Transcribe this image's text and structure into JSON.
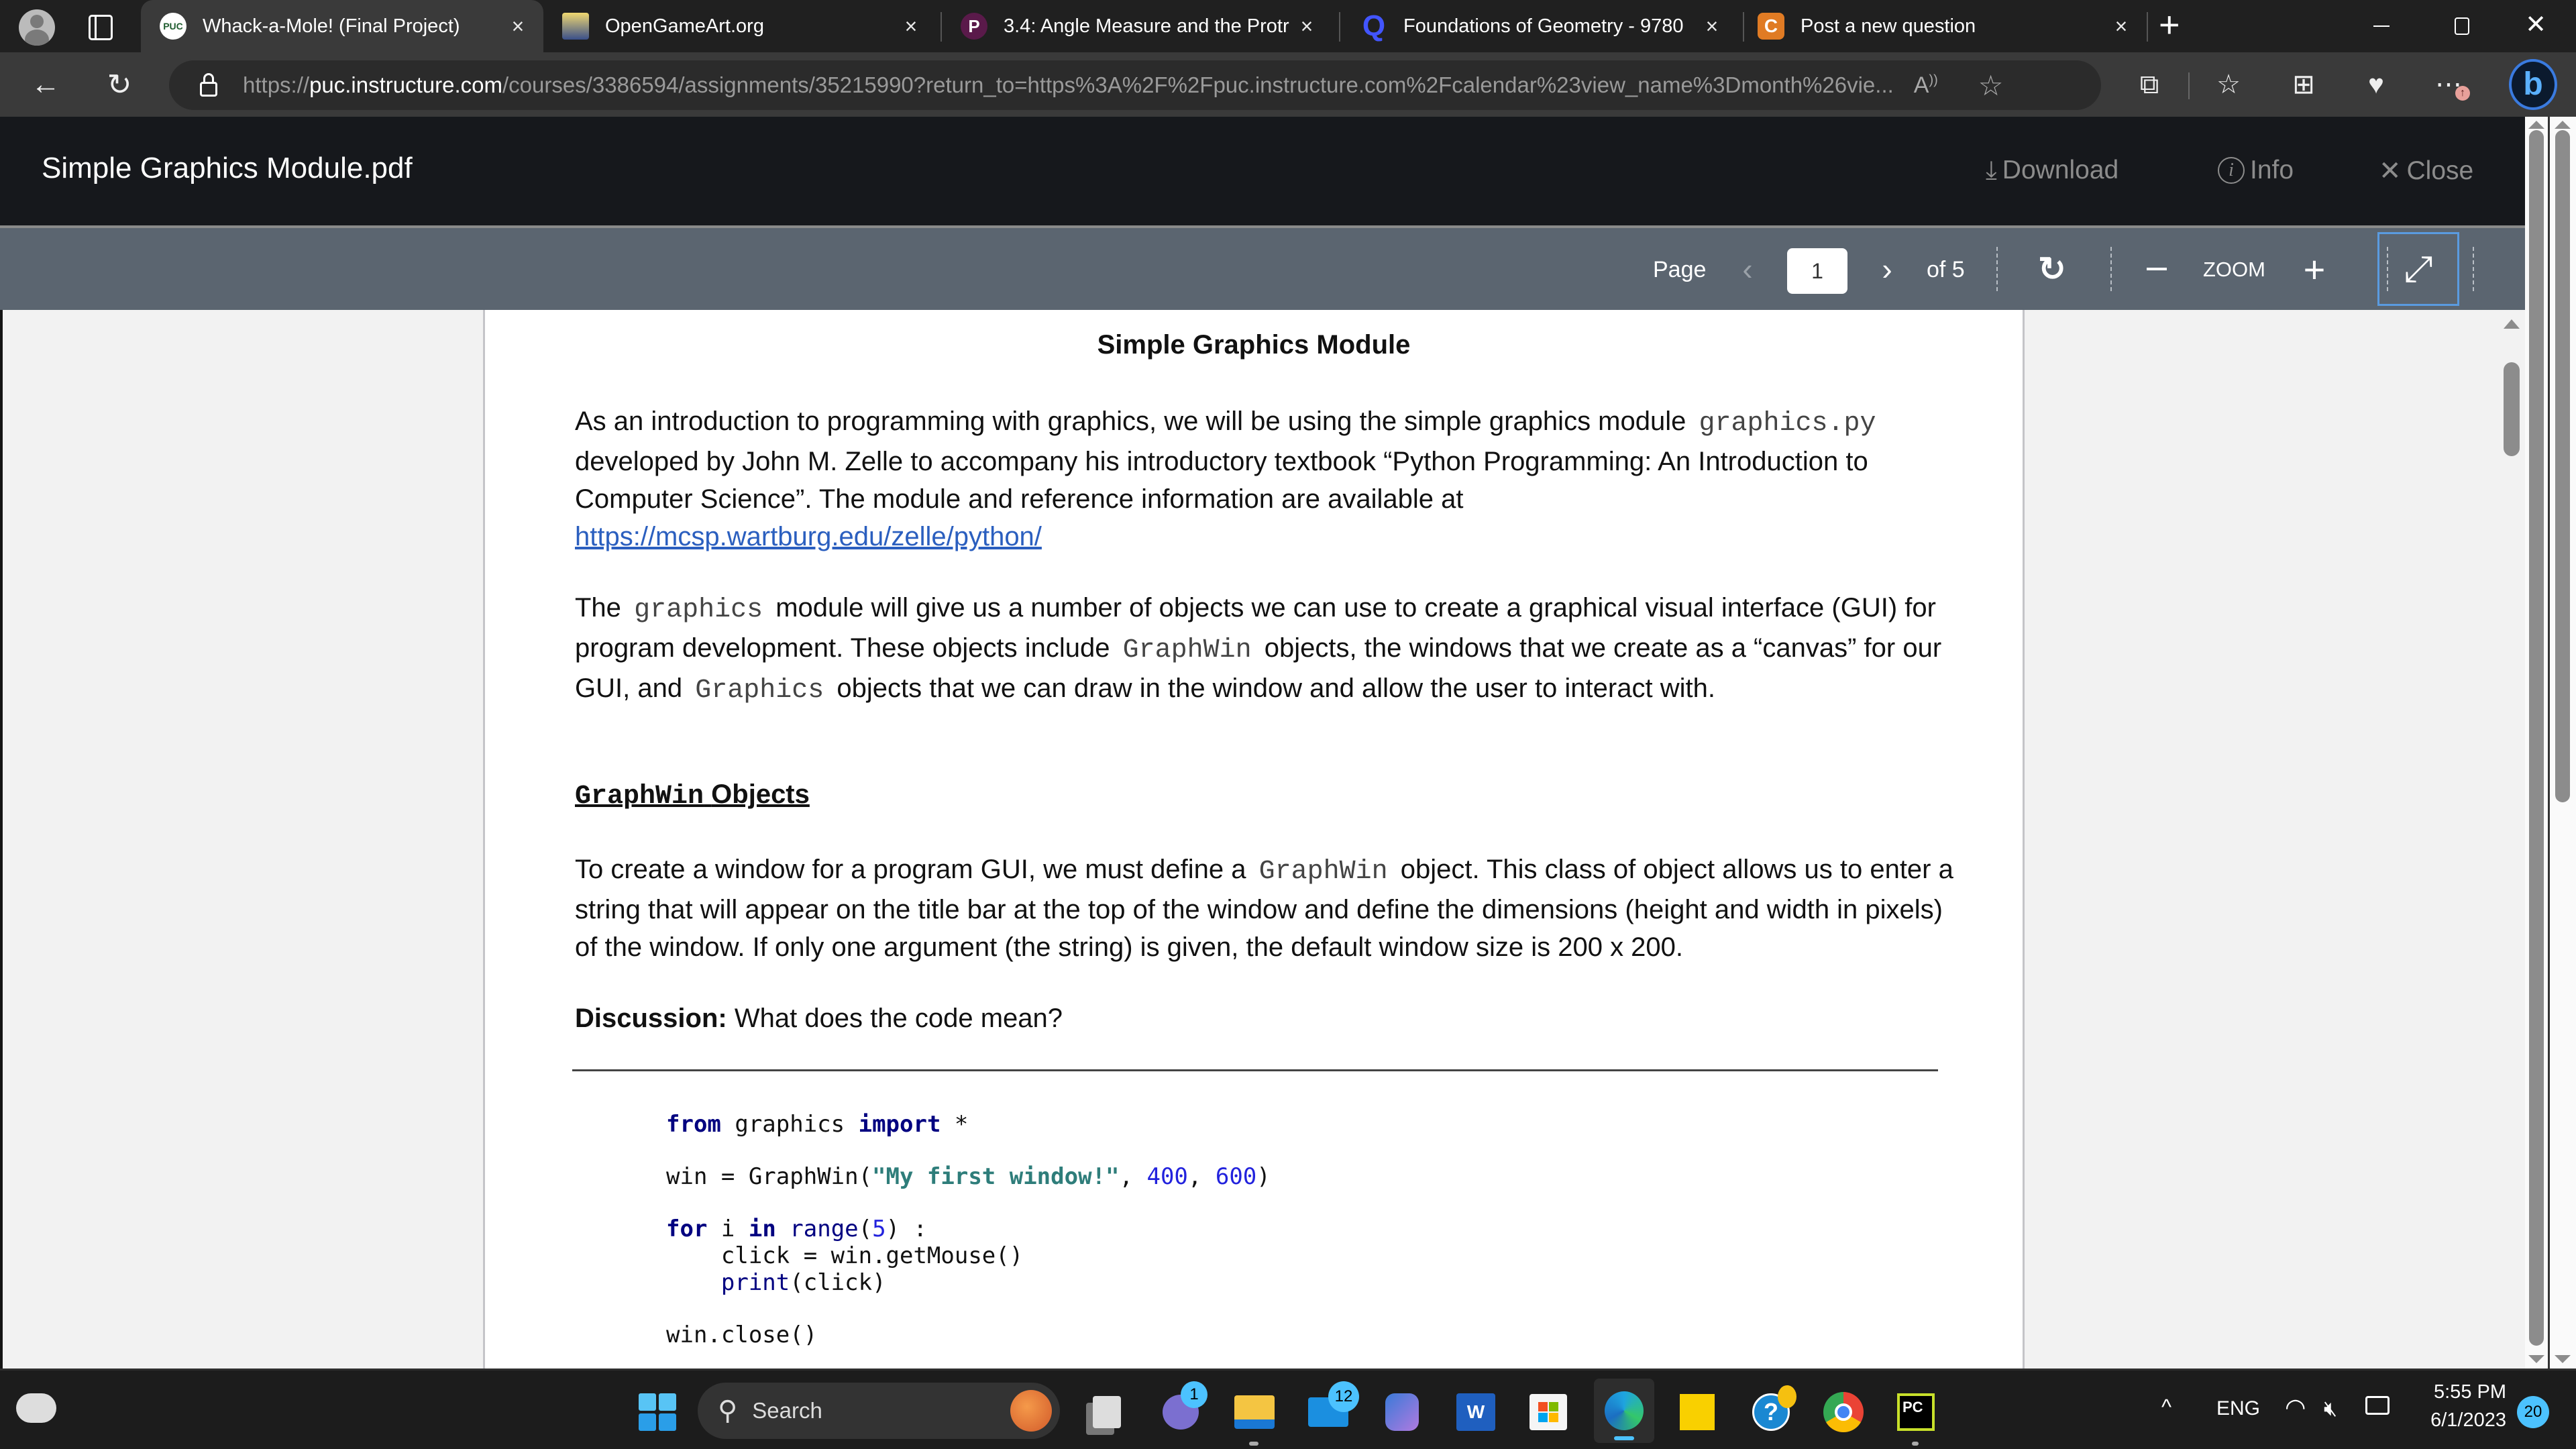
{
  "browser": {
    "tabs": [
      {
        "title": "Whack-a-Mole! (Final Project)",
        "favicon": "puc-logo-icon",
        "favicon_text": "PUC",
        "active": true
      },
      {
        "title": "OpenGameArt.org",
        "favicon": "opengameart-icon",
        "active": false
      },
      {
        "title": "3.4: Angle Measure and the Protr",
        "favicon": "pearson-icon",
        "favicon_text": "P",
        "active": false
      },
      {
        "title": "Foundations of Geometry - 9780",
        "favicon": "quizlet-icon",
        "favicon_text": "Q",
        "active": false
      },
      {
        "title": "Post a new question",
        "favicon": "chegg-icon",
        "favicon_text": "C",
        "active": false
      }
    ],
    "url_prefix": "https://",
    "url_domain": "puc.instructure.com",
    "url_rest": "/courses/3386594/assignments/35215990?return_to=https%3A%2F%2Fpuc.instructure.com%2Fcalendar%23view_name%3Dmonth%26vie...",
    "close_glyph": "×",
    "new_tab_glyph": "+",
    "window_controls": {
      "minimize": "—",
      "restore": "❐",
      "close": "✕"
    }
  },
  "viewer": {
    "file_name": "Simple Graphics Module.pdf",
    "download_label": "Download",
    "info_label": "Info",
    "close_label": "Close",
    "page_label": "Page",
    "current_page": "1",
    "total_pages_label": "of 5",
    "zoom_label": "ZOOM"
  },
  "document": {
    "title": "Simple Graphics Module",
    "para1_a": "As an introduction to programming with graphics, we will be using the simple graphics module",
    "para1_code": "graphics.py",
    "para1_b": "developed by John M. Zelle to accompany his introductory textbook “Python Programming: An Introduction to Computer Science”. The module and reference information are available at",
    "para1_link": "https://mcsp.wartburg.edu/zelle/python/",
    "para2_a": "The",
    "para2_code1": "graphics",
    "para2_b": "module will give us a number of objects we can use to create a graphical visual interface (GUI) for program development. These objects include",
    "para2_code2": "GraphWin",
    "para2_c": "objects, the windows that we create as a “canvas” for our GUI, and",
    "para2_code3": "Graphics",
    "para2_d": "objects that we can draw in the window and allow the user to interact with.",
    "heading_code": "GraphWin",
    "heading_text": "Objects",
    "para3_a": "To create a window for a program GUI, we must define a",
    "para3_code": "GraphWin",
    "para3_b": "object. This class of object allows us to enter a string that will appear on the title bar at the top of the window and define the dimensions (height and width in pixels) of the window. If only one argument (the string) is given, the default window size is 200 x 200.",
    "discussion_label": "Discussion:",
    "discussion_text": "What does the code mean?",
    "code": {
      "l1_kw1": "from",
      "l1_mod": " graphics ",
      "l1_kw2": "import",
      "l1_rest": " *",
      "l2_a": "win = GraphWin(",
      "l2_str": "\"My first window!\"",
      "l2_b": ", ",
      "l2_n1": "400",
      "l2_c": ", ",
      "l2_n2": "600",
      "l2_d": ")",
      "l3_kw1": "for",
      "l3_a": " i ",
      "l3_kw2": "in",
      "l3_b": " ",
      "l3_bi": "range",
      "l3_c": "(",
      "l3_n": "5",
      "l3_d": ") :",
      "l4": "    click = win.getMouse()",
      "l5_indent": "    ",
      "l5_bi": "print",
      "l5_rest": "(click)",
      "l6": "win.close()"
    }
  },
  "taskbar": {
    "search_label": "Search",
    "badges": {
      "teams": "1",
      "mail": "12"
    },
    "tray": {
      "language": "ENG",
      "time": "5:55 PM",
      "date": "6/1/2023",
      "notifications": "20"
    }
  }
}
